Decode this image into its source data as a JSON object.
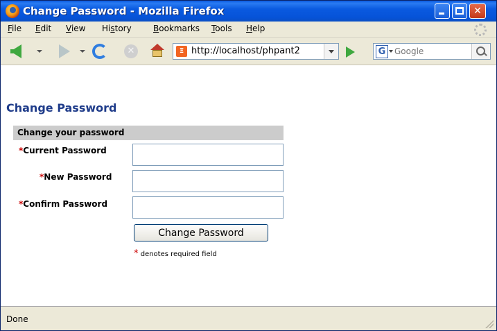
{
  "window": {
    "title": "Change Password - Mozilla Firefox"
  },
  "menu": {
    "items": [
      {
        "label": "File",
        "u": "F",
        "rest": "ile"
      },
      {
        "label": "Edit",
        "u": "E",
        "rest": "dit"
      },
      {
        "label": "View",
        "u": "V",
        "rest": "iew"
      },
      {
        "label": "History",
        "pre": "Hi",
        "u": "s",
        "rest": "tory"
      },
      {
        "label": "Bookmarks",
        "u": "B",
        "rest": "ookmarks"
      },
      {
        "label": "Tools",
        "u": "T",
        "rest": "ools"
      },
      {
        "label": "Help",
        "u": "H",
        "rest": "elp"
      }
    ]
  },
  "toolbar": {
    "url": "http://localhost/phpant2",
    "search_placeholder": "Google",
    "search_engine_letter": "G",
    "site_icon_text": "Ξ"
  },
  "page": {
    "title": "Change Password",
    "form_header": "Change your password",
    "required_marker": "*",
    "fields": {
      "current": "Current Password",
      "new": "New Password",
      "confirm": "Confirm Password"
    },
    "submit_label": "Change Password",
    "note": "denotes required field"
  },
  "status": {
    "text": "Done"
  },
  "colors": {
    "title_bar": "#0a5ae0",
    "page_title": "#1f3c8a",
    "required": "#cc0000",
    "form_header_bg": "#cccccc"
  },
  "icons": {
    "app": "firefox-icon",
    "back": "back-arrow-icon",
    "forward": "forward-arrow-icon",
    "reload": "reload-icon",
    "stop": "stop-icon",
    "home": "home-icon",
    "go": "go-icon",
    "search": "magnifier-icon"
  }
}
